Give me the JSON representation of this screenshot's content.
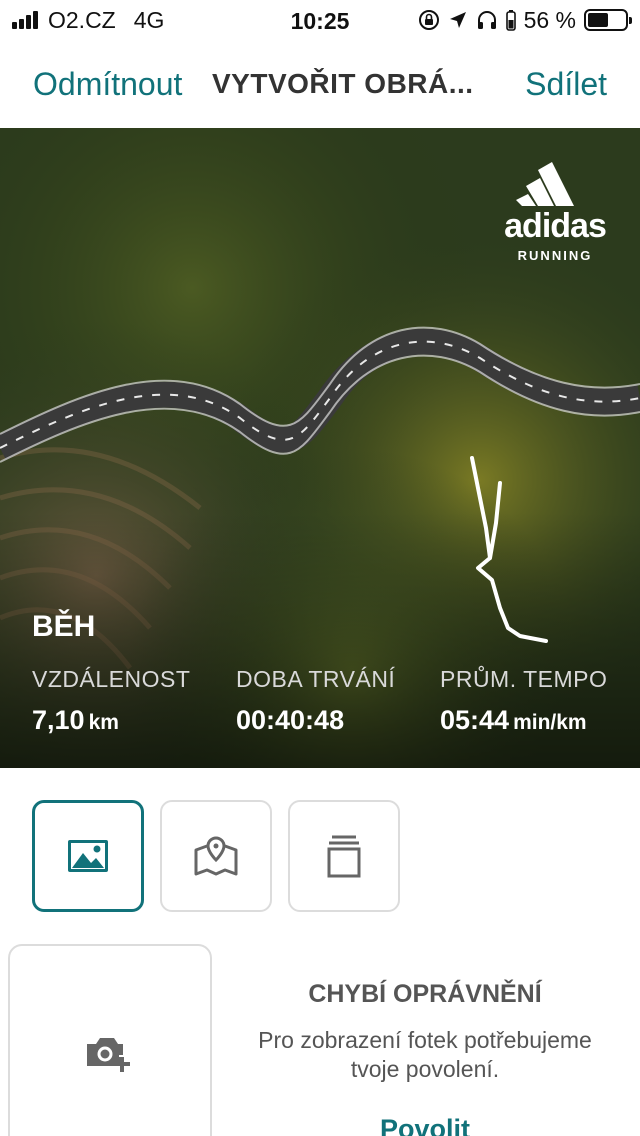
{
  "status_bar": {
    "carrier": "O2.CZ",
    "network": "4G",
    "time": "10:25",
    "battery": "56 %",
    "battery_level": 0.56
  },
  "nav": {
    "cancel_label": "Odmítnout",
    "title": "VYTVOŘIT OBRÁ...",
    "share_label": "Sdílet"
  },
  "preview": {
    "brand": {
      "word": "adidas",
      "sub": "RUNNING"
    },
    "activity_type": "BĚH",
    "stats": [
      {
        "label": "VZDÁLENOST",
        "value": "7,10",
        "unit": "km"
      },
      {
        "label": "DOBA TRVÁNÍ",
        "value": "00:40:48",
        "unit": ""
      },
      {
        "label": "PRŮM. TEMPO",
        "value": "05:44",
        "unit": "min/km"
      }
    ]
  },
  "template_tabs": [
    {
      "icon": "image-icon",
      "active": true
    },
    {
      "icon": "map-icon",
      "active": false
    },
    {
      "icon": "stack-icon",
      "active": false
    }
  ],
  "permission": {
    "title": "CHYBÍ OPRÁVNĚNÍ",
    "text": "Pro zobrazení fotek potřebujeme tvoje povolení.",
    "allow_label": "Povolit"
  },
  "colors": {
    "accent": "#11727a",
    "border": "#dcdcdc"
  }
}
